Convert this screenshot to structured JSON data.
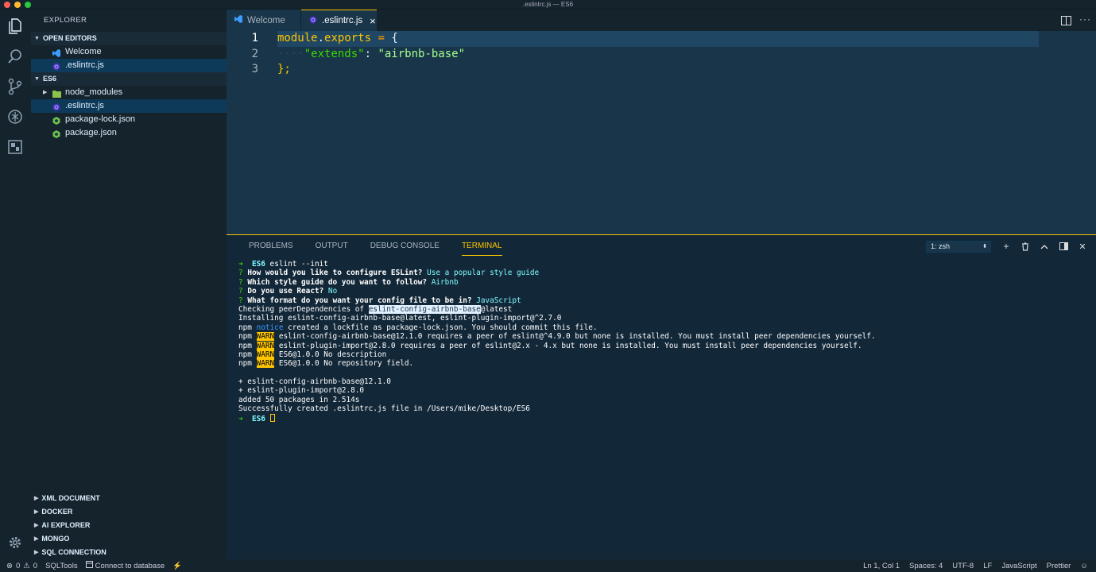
{
  "window": {
    "title": ".eslintrc.js — ES6",
    "colors": {
      "close": "#ff5f56",
      "minimize": "#ffbd2e",
      "maximize": "#27c93f"
    }
  },
  "sidebar": {
    "header": "EXPLORER",
    "open_editors": {
      "title": "OPEN EDITORS",
      "items": [
        {
          "label": "Welcome",
          "icon": "vscode-icon"
        },
        {
          "label": ".eslintrc.js",
          "icon": "eslint-icon"
        }
      ]
    },
    "folder": {
      "title": "ES6",
      "items": [
        {
          "label": "node_modules",
          "icon": "folder-icon"
        },
        {
          "label": ".eslintrc.js",
          "icon": "eslint-icon"
        },
        {
          "label": "package-lock.json",
          "icon": "nodejs-icon"
        },
        {
          "label": "package.json",
          "icon": "nodejs-icon"
        }
      ]
    },
    "bottom_sections": [
      "XML DOCUMENT",
      "DOCKER",
      "AI EXPLORER",
      "MONGO",
      "SQL CONNECTION"
    ]
  },
  "tabs": [
    {
      "label": "Welcome",
      "icon": "vscode-icon"
    },
    {
      "label": ".eslintrc.js",
      "icon": "eslint-icon",
      "close": "×"
    }
  ],
  "editor": {
    "line_numbers": [
      "1",
      "2",
      "3"
    ],
    "lines": [
      {
        "tokens": [
          [
            "module",
            "#ffc600"
          ],
          [
            ".",
            "#e1efff"
          ],
          [
            "exports",
            "#ffc600"
          ],
          [
            " = ",
            "#ff9d00"
          ],
          [
            "{",
            "#e1efff"
          ]
        ]
      },
      {
        "tokens": [
          [
            "····",
            "#2a4a63"
          ],
          [
            "\"extends\"",
            "#3ad900"
          ],
          [
            ": ",
            "#e1efff"
          ],
          [
            "\"airbnb-base\"",
            "#a5ff90"
          ]
        ]
      },
      {
        "tokens": [
          [
            "};",
            "#ffc600"
          ]
        ]
      }
    ]
  },
  "panel": {
    "tabs": [
      "PROBLEMS",
      "OUTPUT",
      "DEBUG CONSOLE",
      "TERMINAL"
    ],
    "terminal_select": "1: zsh",
    "terminal": {
      "prompt_arrow": "➜",
      "prompt_dir": "ES6",
      "init_cmd": "eslint --init",
      "q1": "How would you like to configure ESLint?",
      "a1": "Use a popular style guide",
      "q2": "Which style guide do you want to follow?",
      "a2": "Airbnb",
      "q3": "Do you use React?",
      "a3": "No",
      "q4": "What format do you want your config file to be in?",
      "a4": "JavaScript",
      "q_mark": "?",
      "check_pre": "Checking peerDependencies of ",
      "check_hl": "eslint-config-airbnb-base",
      "check_post": "@latest",
      "install": "Installing eslint-config-airbnb-base@latest, eslint-plugin-import@^2.7.0",
      "npm": "npm",
      "notice": "notice",
      "notice_msg": " created a lockfile as package-lock.json. You should commit this file.",
      "warn": "WARN",
      "warn1": " eslint-config-airbnb-base@12.1.0 requires a peer of eslint@^4.9.0 but none is installed. You must install peer dependencies yourself.",
      "warn2": " eslint-plugin-import@2.8.0 requires a peer of eslint@2.x - 4.x but none is installed. You must install peer dependencies yourself.",
      "warn3": " ES6@1.0.0 No description",
      "warn4": " ES6@1.0.0 No repository field.",
      "added1": "+ eslint-config-airbnb-base@12.1.0",
      "added2": "+ eslint-plugin-import@2.8.0",
      "summary": "added 50 packages in 2.514s",
      "success": "Successfully created .eslintrc.js file in /Users/mike/Desktop/ES6"
    }
  },
  "statusbar": {
    "errors": "0",
    "warnings": "0",
    "sqltools": "SQLTools",
    "connect": "Connect to database",
    "position": "Ln 1, Col 1",
    "spaces": "Spaces: 4",
    "encoding": "UTF-8",
    "eol": "LF",
    "language": "JavaScript",
    "formatter": "Prettier"
  }
}
